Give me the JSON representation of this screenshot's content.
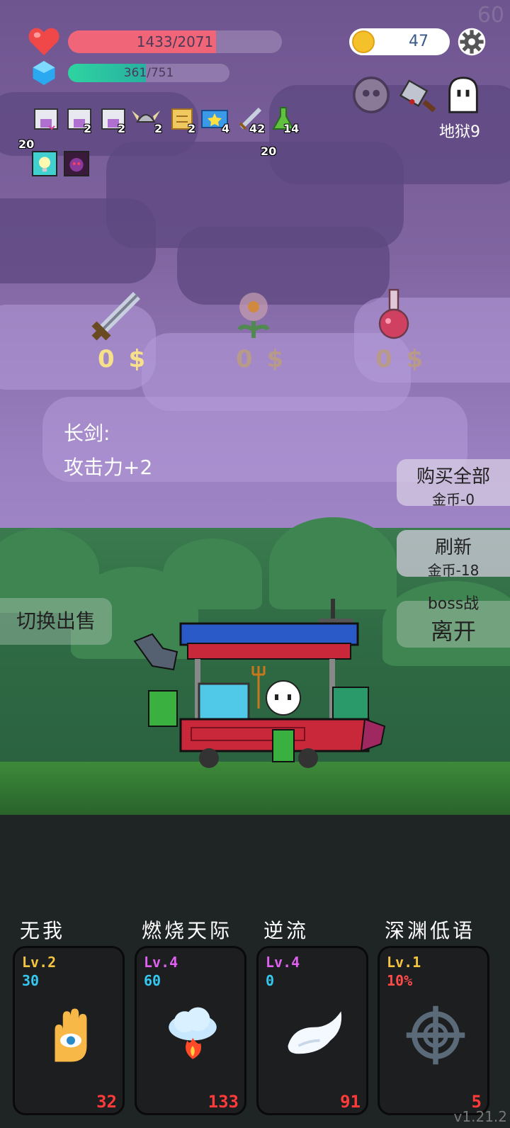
{
  "fps": "60",
  "player": {
    "hp_text": "1433/2071",
    "hp_fraction": 0.692,
    "mp_text": "361/751",
    "mp_fraction": 0.481
  },
  "currency": {
    "coins": "47"
  },
  "level": {
    "label": "地狱9"
  },
  "stat_items": [
    {
      "icon": "shirt-armor-icon",
      "count": ""
    },
    {
      "icon": "pants-armor-icon",
      "count": "2"
    },
    {
      "icon": "boots-armor-icon",
      "count": "2"
    },
    {
      "icon": "viking-helmet-icon",
      "count": "2"
    },
    {
      "icon": "scroll-icon",
      "count": "2"
    },
    {
      "icon": "star-card-icon",
      "count": "4"
    },
    {
      "icon": "sword-icon",
      "count": "42"
    },
    {
      "icon": "potion-flask-icon",
      "count": "14"
    }
  ],
  "stat_extra_left": "20",
  "stat_extra_mid": "20",
  "buffs": [
    "lightbulb-buff-icon",
    "demon-buff-icon"
  ],
  "top_right_icons": [
    "ghost-skull-icon",
    "cleaver-icon",
    "ghost-icon"
  ],
  "shop": {
    "items": [
      {
        "name": "sword-item",
        "price": "0 $",
        "color": "#f7e08a"
      },
      {
        "name": "flower-item",
        "price": "0 $",
        "color": "#b89a8a"
      },
      {
        "name": "potion-item",
        "price": "0 $",
        "color": "#b89a8a"
      }
    ],
    "desc_title": "长剑:",
    "desc_text": "攻击力+2"
  },
  "buttons": {
    "buy_all": "购买全部",
    "buy_all_cost": "金币-0",
    "refresh": "刷新",
    "refresh_cost": "金币-18",
    "boss_label": "boss战",
    "leave": "离开",
    "switch_sell": "切换出售"
  },
  "skills": [
    {
      "title": "无我",
      "lv": "Lv.2",
      "lv_color": "#f5c542",
      "val": "30",
      "val_color": "#35c8f0",
      "count": "32",
      "icon": "eye-hand-icon"
    },
    {
      "title": "燃烧天际",
      "lv": "Lv.4",
      "lv_color": "#e060f0",
      "val": "60",
      "val_color": "#35c8f0",
      "count": "133",
      "icon": "fire-cloud-icon"
    },
    {
      "title": "逆流",
      "lv": "Lv.4",
      "lv_color": "#e060f0",
      "val": "0",
      "val_color": "#35c8f0",
      "count": "91",
      "icon": "wing-icon"
    },
    {
      "title": "深渊低语",
      "lv": "Lv.1",
      "lv_color": "#f5c542",
      "val": "10%",
      "val_color": "#ff4a4a",
      "count": "5",
      "icon": "crosshair-icon"
    }
  ],
  "version": "v1.21.2"
}
